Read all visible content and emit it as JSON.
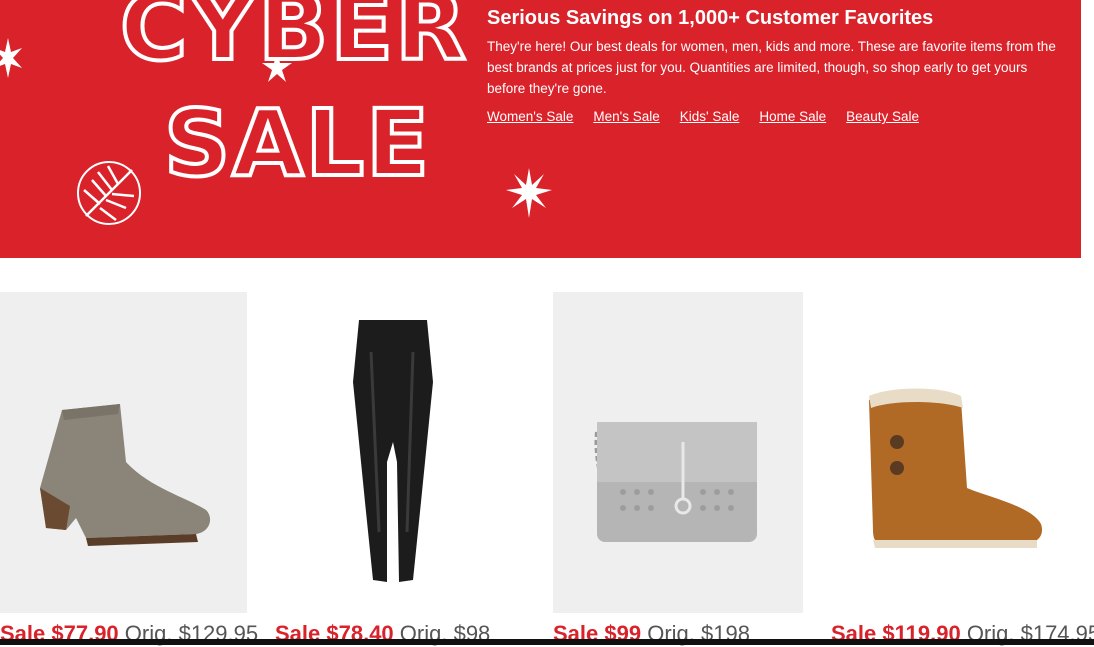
{
  "banner": {
    "headline_line1": "CYBER",
    "headline_line2": "SALE",
    "title": "Serious Savings on 1,000+ Customer Favorites",
    "description": "They're here! Our best deals for women, men, kids and more. These are favorite items from the best brands at prices just for you. Quantities are limited, though, so shop early to get yours before they're gone.",
    "links": [
      {
        "label": "Women's Sale"
      },
      {
        "label": "Men's Sale"
      },
      {
        "label": "Kids' Sale"
      },
      {
        "label": "Home Sale"
      },
      {
        "label": "Beauty Sale"
      }
    ]
  },
  "products": [
    {
      "name": "ankle-bootie",
      "sale_price": "Sale $77.90",
      "orig_price": "Orig. $129.95"
    },
    {
      "name": "faux-leather-leggings",
      "sale_price": "Sale $78.40",
      "orig_price": "Orig. $98"
    },
    {
      "name": "crossbody-bag",
      "sale_price": "Sale $99",
      "orig_price": "Orig. $198"
    },
    {
      "name": "shearling-boot",
      "sale_price": "Sale $119.90",
      "orig_price": "Orig. $174.95"
    }
  ],
  "colors": {
    "banner_red": "#d9222a",
    "text_white": "#ffffff"
  }
}
